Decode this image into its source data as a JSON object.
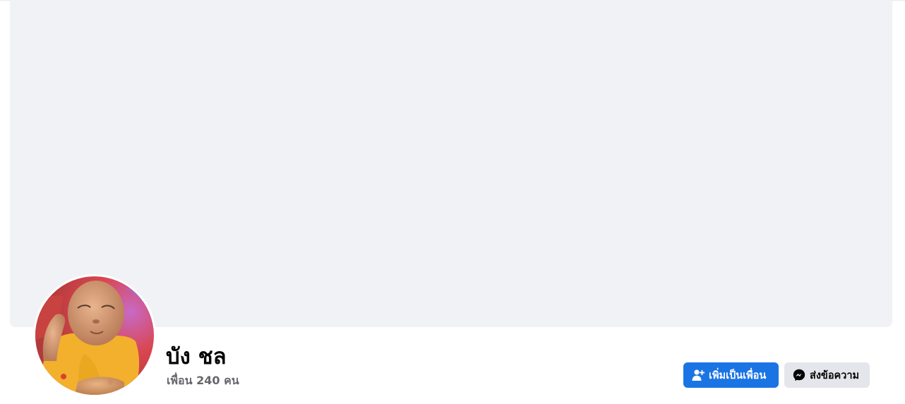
{
  "profile": {
    "name": "บัง ชล",
    "friends_text": "เพื่อน 240 คน"
  },
  "actions": {
    "add_friend_label": "เพิ่มเป็นเพื่อน",
    "add_friend_icon": "person-add-icon",
    "message_label": "ส่งข้อความ",
    "message_icon": "messenger-icon"
  },
  "colors": {
    "primary_button": "#1b74e4",
    "secondary_button": "#e4e6eb",
    "cover_placeholder": "#f0f2f5",
    "secondary_text": "#65676b"
  }
}
